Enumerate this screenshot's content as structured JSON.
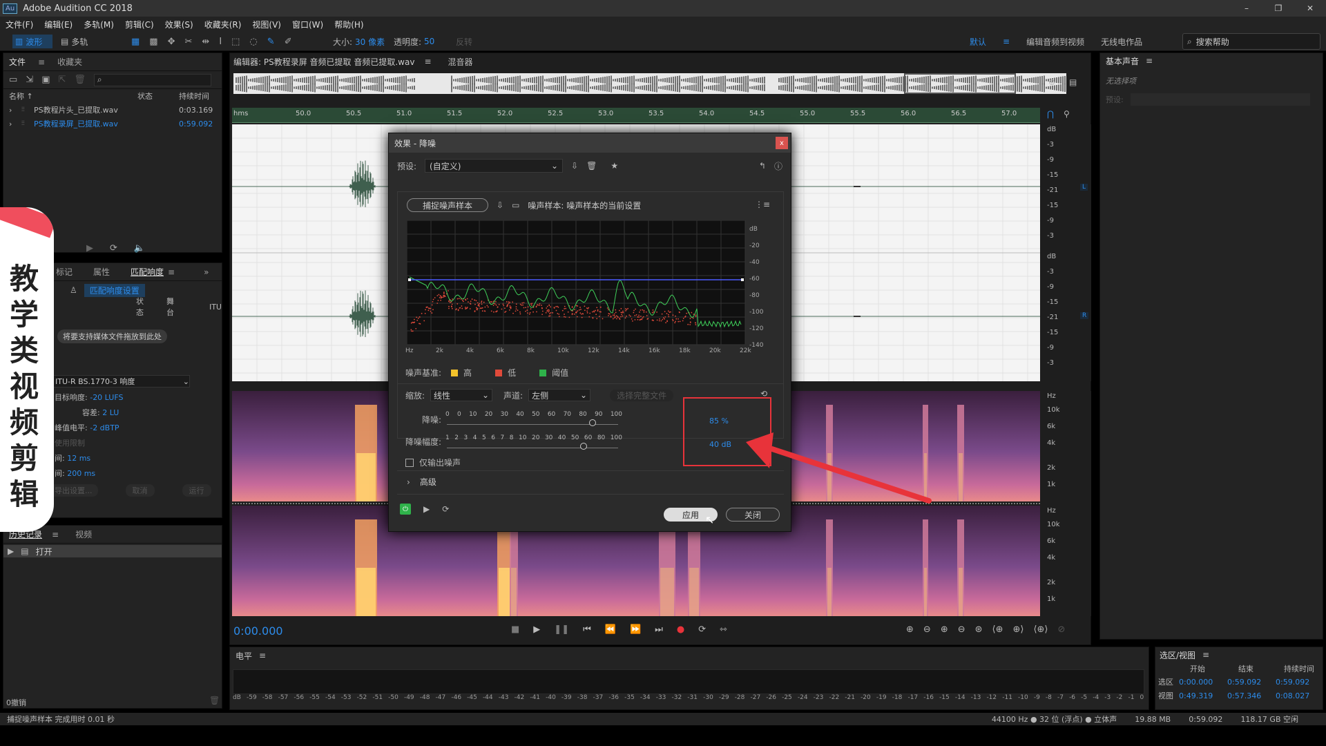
{
  "app": {
    "icon": "Au",
    "title": "Adobe Audition CC 2018"
  },
  "window_controls": {
    "minimize": "–",
    "restore": "❐",
    "close": "✕"
  },
  "menu": [
    "文件(F)",
    "编辑(E)",
    "多轨(M)",
    "剪辑(C)",
    "效果(S)",
    "收藏夹(R)",
    "视图(V)",
    "窗口(W)",
    "帮助(H)"
  ],
  "toolbar": {
    "waveform": "波形",
    "multitrack": "多轨",
    "size_label": "大小:",
    "size_value": "30 像素",
    "opacity_label": "透明度:",
    "opacity_value": "50",
    "invert": "反转",
    "workspaces": [
      "默认",
      "编辑音频到视频",
      "无线电作品"
    ],
    "search": "搜索帮助"
  },
  "files_panel": {
    "tabs": [
      "文件",
      "收藏夹"
    ],
    "col_name": "名称 ↑",
    "col_state": "状态",
    "col_duration": "持续时间",
    "files": [
      {
        "name": "PS教程片头_已提取.wav",
        "duration": "0:03.169"
      },
      {
        "name": "PS教程录屏_已提取.wav",
        "duration": "0:59.092"
      }
    ]
  },
  "loudness_panel": {
    "tabs": [
      "标记",
      "属性",
      "匹配响度"
    ],
    "settings_button": "匹配响度设置",
    "col_state": "状态",
    "col_stage": "舞台",
    "col_itu": "ITU",
    "drop_hint": "将要支持媒体文件拖放到此处",
    "standard": "ITU-R BS.1770-3 响度",
    "target_label": "目标响度:",
    "target_value": "-20 LUFS",
    "tolerance_label": "容差:",
    "tolerance_value": "2 LU",
    "peak_label": "峰值电平:",
    "peak_value": "-2 dBTP",
    "limiter_label": "使用限制",
    "lookahead_label": "间:",
    "lookahead_value": "12 ms",
    "release_label": "间:",
    "release_value": "200 ms",
    "export_settings": "导出设置...",
    "cancel": "取消",
    "run": "运行"
  },
  "history_panel": {
    "tabs": [
      "历史记录",
      "视频"
    ],
    "item": "打开",
    "undo": "0撤销"
  },
  "status_left": "捕捉噪声样本 完成用时 0.01 秒",
  "editor": {
    "tab": "编辑器: PS教程录屏 音频已提取 音频已提取.wav",
    "mixer_tab": "混音器",
    "ruler_unit": "hms",
    "ruler_ticks": [
      "50.0",
      "50.5",
      "51.0",
      "51.5",
      "52.0",
      "52.5",
      "53.0",
      "53.5",
      "54.0",
      "54.5",
      "55.0",
      "55.5",
      "56.0",
      "56.5",
      "57.0"
    ],
    "db_ticks_top": [
      "dB",
      "-3",
      "-9",
      "-15",
      "-21",
      "-15",
      "-9",
      "-3"
    ],
    "db_ticks_bottom": [
      "dB",
      "-3",
      "-9",
      "-15",
      "-21",
      "-15",
      "-9",
      "-3"
    ],
    "channel_L": "L",
    "channel_R": "R",
    "hz_ticks_top": [
      "Hz",
      "10k",
      "6k",
      "4k",
      "2k",
      "1k"
    ],
    "hz_ticks_bottom": [
      "Hz",
      "10k",
      "6k",
      "4k",
      "2k",
      "1k"
    ],
    "time": "0:00.000"
  },
  "dialog": {
    "title": "效果 - 降噪",
    "preset_label": "预设:",
    "preset_value": "(自定义)",
    "capture_button": "捕捉噪声样本",
    "sample_label": "噪声样本: 噪声样本的当前设置",
    "graph_db": [
      "dB",
      "-20",
      "-40",
      "-60",
      "-80",
      "-100",
      "-120",
      "-140"
    ],
    "graph_hz": [
      "Hz",
      "2k",
      "4k",
      "6k",
      "8k",
      "10k",
      "12k",
      "14k",
      "16k",
      "18k",
      "20k",
      "22k"
    ],
    "legend_label": "噪声基准:",
    "legend": [
      {
        "label": "高",
        "color": "#f3c22b"
      },
      {
        "label": "低",
        "color": "#e04a3a"
      },
      {
        "label": "阈值",
        "color": "#2fb24a"
      }
    ],
    "scale_label": "缩放:",
    "scale_value": "线性",
    "channel_label": "声道:",
    "channel_value": "左侧",
    "select_file": "选择完整文件",
    "reduction_label": "降噪:",
    "reduction_ticks": [
      "0",
      "0",
      "10",
      "20",
      "30",
      "40",
      "50",
      "60",
      "70",
      "80",
      "90",
      "100"
    ],
    "reduction_value": "85",
    "reduction_unit": "%",
    "reduction_fraction": 0.85,
    "amount_label": "降噪幅度:",
    "amount_ticks": [
      "1",
      "2",
      "3",
      "4",
      "5",
      "6",
      "7",
      "8",
      "10",
      "20",
      "30",
      "40",
      "50",
      "60",
      "80",
      "100"
    ],
    "amount_value": "40",
    "amount_unit": "dB",
    "amount_fraction": 0.8,
    "output_noise_only": "仅输出噪声",
    "advanced": "高级",
    "apply": "应用",
    "close": "关闭"
  },
  "levels_panel": {
    "title": "电平",
    "ticks": [
      "dB",
      "-59",
      "-58",
      "-57",
      "-56",
      "-55",
      "-54",
      "-53",
      "-52",
      "-51",
      "-50",
      "-49",
      "-48",
      "-47",
      "-46",
      "-45",
      "-44",
      "-43",
      "-42",
      "-41",
      "-40",
      "-39",
      "-38",
      "-37",
      "-36",
      "-35",
      "-34",
      "-33",
      "-32",
      "-31",
      "-30",
      "-29",
      "-28",
      "-27",
      "-26",
      "-25",
      "-24",
      "-23",
      "-22",
      "-21",
      "-20",
      "-19",
      "-18",
      "-17",
      "-16",
      "-15",
      "-14",
      "-13",
      "-12",
      "-11",
      "-10",
      "-9",
      "-8",
      "-7",
      "-6",
      "-5",
      "-4",
      "-3",
      "-2",
      "-1",
      "0"
    ]
  },
  "essential_sound": {
    "title": "基本声音",
    "no_selection": "无选择项",
    "preset": "预设:"
  },
  "selection_view": {
    "title": "选区/视图",
    "cols": [
      "开始",
      "结束",
      "持续时间"
    ],
    "rows": [
      {
        "label": "选区",
        "start": "0:00.000",
        "end": "0:59.092",
        "duration": "0:59.092"
      },
      {
        "label": "视图",
        "start": "0:49.319",
        "end": "0:57.346",
        "duration": "0:08.027"
      }
    ]
  },
  "statusbar": {
    "format": "44100 Hz ● 32 位 (浮点) ● 立体声",
    "size": "19.88 MB",
    "duration": "0:59.092",
    "free": "118.17 GB 空闲"
  },
  "overlay_text": "教学类视频剪辑",
  "accent": "#2d8ceb",
  "highlight": "#e8333a"
}
